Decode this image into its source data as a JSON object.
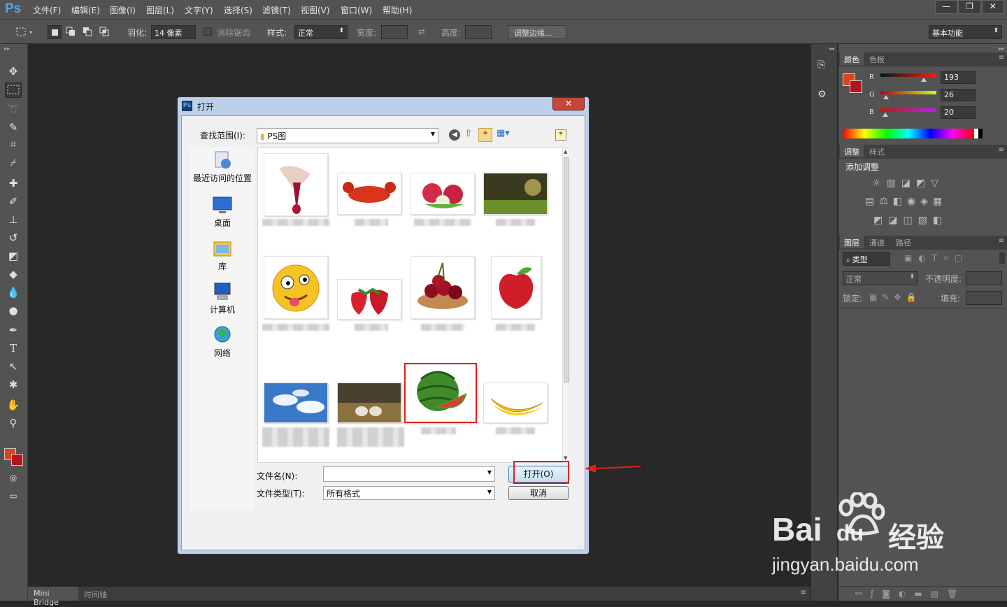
{
  "app": {
    "logo": "Ps",
    "menu": [
      "文件(F)",
      "编辑(E)",
      "图像(I)",
      "图层(L)",
      "文字(Y)",
      "选择(S)",
      "滤镜(T)",
      "视图(V)",
      "窗口(W)",
      "帮助(H)"
    ],
    "window_controls": [
      "—",
      "❐",
      "✕"
    ]
  },
  "options": {
    "feather_label": "羽化:",
    "feather_value": "14 像素",
    "antialias_label": "消除锯齿",
    "style_label": "样式:",
    "style_value": "正常",
    "width_label": "宽度:",
    "height_label": "高度:",
    "refine_edge": "调整边缘...",
    "workspace": "基本功能"
  },
  "color_panel": {
    "tabs": [
      "颜色",
      "色板"
    ],
    "r_label": "R",
    "r_value": "193",
    "g_label": "G",
    "g_value": "26",
    "b_label": "B",
    "b_value": "20",
    "foreground": "#c1341a",
    "background": "#b4141a"
  },
  "adjust_panel": {
    "tabs": [
      "调整",
      "样式"
    ],
    "heading": "添加调整"
  },
  "layers_panel": {
    "tabs": [
      "图层",
      "通道",
      "路径"
    ],
    "filter_label": "类型",
    "blend_mode": "正常",
    "opacity_label": "不透明度:",
    "lock_label": "锁定:",
    "fill_label": "填充:"
  },
  "bottom": {
    "tabs": [
      "Mini Bridge",
      "时间轴"
    ]
  },
  "dialog": {
    "title": "打开",
    "look_in_label": "查找范围(I):",
    "look_in_value": "PS图",
    "places": [
      "最近访问的位置",
      "桌面",
      "库",
      "计算机",
      "网络"
    ],
    "filename_label": "文件名(N):",
    "filename_value": "",
    "filetype_label": "文件类型(T):",
    "filetype_value": "所有格式",
    "open_button": "打开(O)",
    "cancel_button": "取消",
    "thumbnails": [
      "hands-icon",
      "lobster-icon",
      "lychee-icon",
      "forest-icon",
      "emoji-icon",
      "strawberry-icon",
      "cherry-icon",
      "apple-icon",
      "sky-icon",
      "sheep-icon",
      "watermelon-icon",
      "banana-icon"
    ]
  },
  "watermark": {
    "brand": "Bai",
    "brand_suffix": "经验",
    "url": "jingyan.baidu.com"
  }
}
